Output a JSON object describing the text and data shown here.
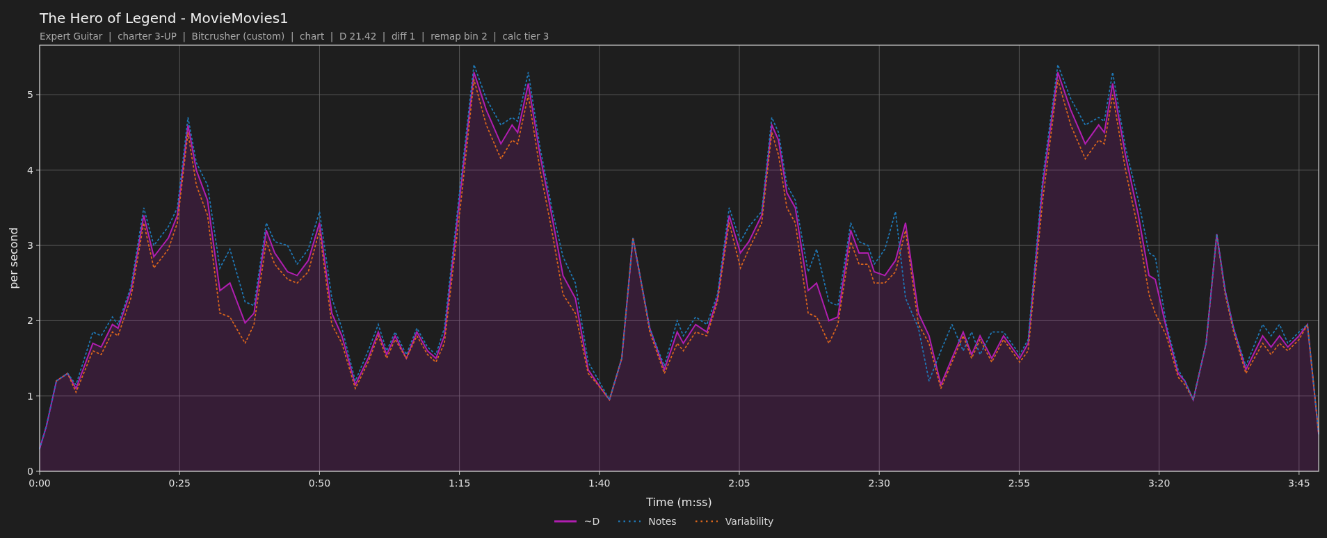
{
  "title": "The Hero of Legend - MovieMovies1",
  "subtitle": "Expert Guitar  |  charter 3-UP  |  Bitcrusher (custom)  |  chart  |  D 21.42  |  diff 1  |  remap bin 2  |  calc tier 3",
  "chart": {
    "chart_data": {
      "type": "line",
      "grid": true,
      "xlabel": "Time (m:ss)",
      "ylabel": "per second",
      "xlim": [
        0,
        228.5
      ],
      "ylim": [
        0,
        5.66
      ],
      "xticks": [
        {
          "value": 0,
          "label": "0:00"
        },
        {
          "value": 25,
          "label": "0:25"
        },
        {
          "value": 50,
          "label": "0:50"
        },
        {
          "value": 75,
          "label": "1:15"
        },
        {
          "value": 100,
          "label": "1:40"
        },
        {
          "value": 125,
          "label": "2:05"
        },
        {
          "value": 150,
          "label": "2:30"
        },
        {
          "value": 175,
          "label": "2:55"
        },
        {
          "value": 200,
          "label": "3:20"
        },
        {
          "value": 225,
          "label": "3:45"
        }
      ],
      "yticks": [
        0,
        1,
        2,
        3,
        4,
        5
      ],
      "x": [
        0,
        1.2,
        3,
        5,
        6.5,
        9.5,
        11,
        13,
        14,
        16.3,
        18.6,
        20.4,
        23,
        24.6,
        26.5,
        28,
        30,
        32.2,
        34,
        36.7,
        38.3,
        40.5,
        42,
        44.3,
        46,
        48,
        50,
        52.2,
        54,
        56.4,
        58.7,
        60.5,
        62,
        63.5,
        65.5,
        67.4,
        69.3,
        70.8,
        72.3,
        75.3,
        77.6,
        79.8,
        82.4,
        84.4,
        85.4,
        87.3,
        89.4,
        91.5,
        93.5,
        95.7,
        98,
        100.3,
        101.8,
        104,
        106,
        107,
        109,
        111.6,
        113.9,
        115,
        117.2,
        119.2,
        121.1,
        123.2,
        125.2,
        126.7,
        129,
        130.8,
        132,
        133.5,
        135,
        137.3,
        138.8,
        141,
        142.6,
        144.9,
        146.4,
        148,
        149.1,
        151,
        152.9,
        154.7,
        157,
        158.9,
        161,
        163,
        165,
        166.5,
        168,
        170.1,
        172.2,
        175.1,
        176.6,
        179.2,
        181.9,
        184.2,
        186.8,
        189.2,
        190.2,
        191.7,
        194,
        196.3,
        198.2,
        199.3,
        201.3,
        203.4,
        204.6,
        206.1,
        208.4,
        210.3,
        211.8,
        213.3,
        215.5,
        218.5,
        220,
        221.5,
        223,
        225,
        226.5,
        228.5
      ],
      "series": [
        {
          "name": "~D",
          "color": "#b01eb0",
          "line_style": "solid",
          "type": "area",
          "values": [
            0.3,
            0.6,
            1.2,
            1.3,
            1.1,
            1.7,
            1.65,
            1.95,
            1.9,
            2.4,
            3.4,
            2.85,
            3.1,
            3.4,
            4.6,
            4.0,
            3.6,
            2.4,
            2.5,
            1.97,
            2.1,
            3.2,
            2.9,
            2.65,
            2.6,
            2.8,
            3.3,
            2.1,
            1.8,
            1.15,
            1.5,
            1.85,
            1.55,
            1.8,
            1.5,
            1.85,
            1.6,
            1.5,
            1.8,
            3.8,
            5.3,
            4.8,
            4.35,
            4.6,
            4.5,
            5.15,
            4.2,
            3.4,
            2.6,
            2.3,
            1.35,
            1.1,
            0.95,
            1.5,
            3.1,
            2.7,
            1.9,
            1.35,
            1.85,
            1.7,
            1.95,
            1.85,
            2.3,
            3.4,
            2.9,
            3.05,
            3.4,
            4.6,
            4.4,
            3.7,
            3.5,
            2.4,
            2.5,
            2.0,
            2.05,
            3.2,
            2.9,
            2.9,
            2.65,
            2.6,
            2.8,
            3.3,
            2.1,
            1.8,
            1.15,
            1.5,
            1.85,
            1.55,
            1.8,
            1.5,
            1.8,
            1.5,
            1.7,
            3.8,
            5.3,
            4.8,
            4.35,
            4.6,
            4.5,
            5.15,
            4.2,
            3.4,
            2.6,
            2.55,
            1.9,
            1.3,
            1.2,
            0.95,
            1.7,
            3.15,
            2.4,
            1.9,
            1.35,
            1.8,
            1.65,
            1.8,
            1.65,
            1.8,
            1.95,
            0.5
          ]
        },
        {
          "name": "Notes",
          "color": "#1f77b4",
          "line_style": "dotted",
          "type": "line",
          "values": [
            0.3,
            0.6,
            1.2,
            1.3,
            1.15,
            1.85,
            1.8,
            2.05,
            1.95,
            2.45,
            3.5,
            3.0,
            3.25,
            3.5,
            4.7,
            4.1,
            3.8,
            2.7,
            2.95,
            2.25,
            2.2,
            3.3,
            3.05,
            3.0,
            2.75,
            2.95,
            3.45,
            2.3,
            1.9,
            1.2,
            1.6,
            1.95,
            1.6,
            1.85,
            1.55,
            1.9,
            1.65,
            1.55,
            1.9,
            3.9,
            5.4,
            4.95,
            4.6,
            4.7,
            4.65,
            5.3,
            4.3,
            3.5,
            2.85,
            2.5,
            1.45,
            1.15,
            0.95,
            1.5,
            3.1,
            2.7,
            1.9,
            1.4,
            2.0,
            1.8,
            2.05,
            1.95,
            2.35,
            3.5,
            3.05,
            3.25,
            3.45,
            4.7,
            4.5,
            3.8,
            3.6,
            2.65,
            2.95,
            2.25,
            2.2,
            3.3,
            3.05,
            3.0,
            2.75,
            2.95,
            3.45,
            2.3,
            1.9,
            1.2,
            1.6,
            1.95,
            1.6,
            1.85,
            1.55,
            1.85,
            1.85,
            1.55,
            1.75,
            3.9,
            5.4,
            4.95,
            4.6,
            4.7,
            4.65,
            5.3,
            4.3,
            3.6,
            2.9,
            2.85,
            1.95,
            1.35,
            1.2,
            0.95,
            1.7,
            3.15,
            2.4,
            1.9,
            1.4,
            1.95,
            1.8,
            1.95,
            1.7,
            1.85,
            1.95,
            0.5
          ]
        },
        {
          "name": "Variability",
          "color": "#d8651c",
          "line_style": "dotted",
          "type": "line",
          "values": [
            null,
            null,
            1.2,
            1.3,
            1.05,
            1.6,
            1.55,
            1.85,
            1.8,
            2.3,
            3.3,
            2.7,
            2.95,
            3.3,
            4.5,
            3.8,
            3.4,
            2.1,
            2.05,
            1.7,
            1.95,
            3.05,
            2.75,
            2.55,
            2.5,
            2.65,
            3.2,
            1.95,
            1.7,
            1.1,
            1.45,
            1.8,
            1.5,
            1.75,
            1.5,
            1.8,
            1.55,
            1.45,
            1.7,
            3.6,
            5.2,
            4.6,
            4.15,
            4.4,
            4.35,
            5.0,
            4.0,
            3.2,
            2.35,
            2.1,
            1.3,
            1.1,
            0.95,
            1.5,
            3.1,
            2.7,
            1.85,
            1.3,
            1.7,
            1.6,
            1.85,
            1.8,
            2.25,
            3.3,
            2.7,
            2.95,
            3.3,
            4.5,
            4.2,
            3.5,
            3.3,
            2.1,
            2.05,
            1.7,
            1.95,
            3.05,
            2.75,
            2.75,
            2.5,
            2.5,
            2.65,
            3.2,
            1.95,
            1.7,
            1.1,
            1.45,
            1.8,
            1.5,
            1.75,
            1.45,
            1.75,
            1.45,
            1.6,
            3.6,
            5.2,
            4.6,
            4.15,
            4.4,
            4.35,
            5.0,
            4.0,
            3.2,
            2.35,
            2.1,
            1.8,
            1.25,
            1.15,
            0.95,
            1.7,
            3.15,
            2.35,
            1.85,
            1.3,
            1.7,
            1.55,
            1.7,
            1.6,
            1.75,
            1.95,
            0.5
          ]
        }
      ]
    }
  }
}
